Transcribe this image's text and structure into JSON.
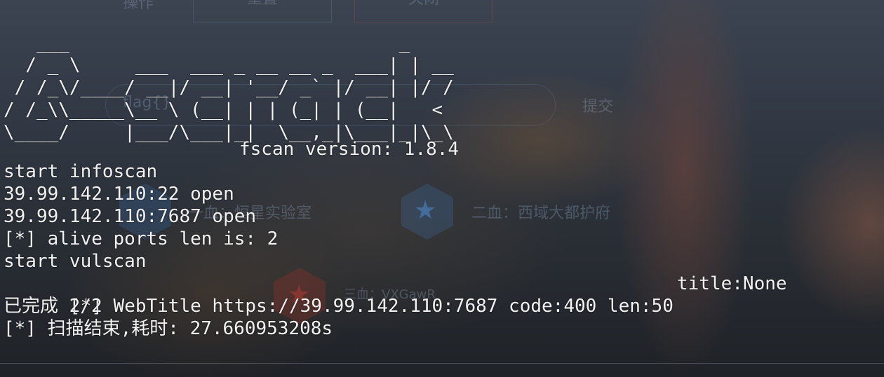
{
  "background": {
    "top_buttons": [
      "操作",
      "重置",
      "关闭"
    ],
    "flag_placeholder": "flag{}",
    "submit_label": "提交",
    "first_blood": "一血：恒星实验室",
    "second_blood": "二血：西域大都护府",
    "third_blood": "三血：VXGawR",
    "colors": {
      "hex_blue": "#3c6eaa",
      "hex_red": "#aa3228"
    }
  },
  "terminal": {
    "banner": "   ___                              _\n  / _ \\     ___  ___ _ __ __ _  ___| | __\n / /_\\/____/ __|/ __| '__/ _` |/ __| |/ /\n/ /_\\\\_____\\__ \\ (__| | | (_| | (__|   <\n\\____/     |___/\\___|_|  \\__,_|\\___|_|\\_\\",
    "version": "fscan version: 1.8.4",
    "lines": [
      "start infoscan",
      "39.99.142.110:22 open",
      "39.99.142.110:7687 open",
      "[*] alive ports len is: 2",
      "start vulscan",
      "[*] WebTitle https://39.99.142.110:7687 code:400 len:50",
      "已完成 2/2",
      "[*] 扫描结束,耗时: 27.660953208s"
    ],
    "webtitle_title": "title:None",
    "text_color": "#f2f2f2"
  }
}
